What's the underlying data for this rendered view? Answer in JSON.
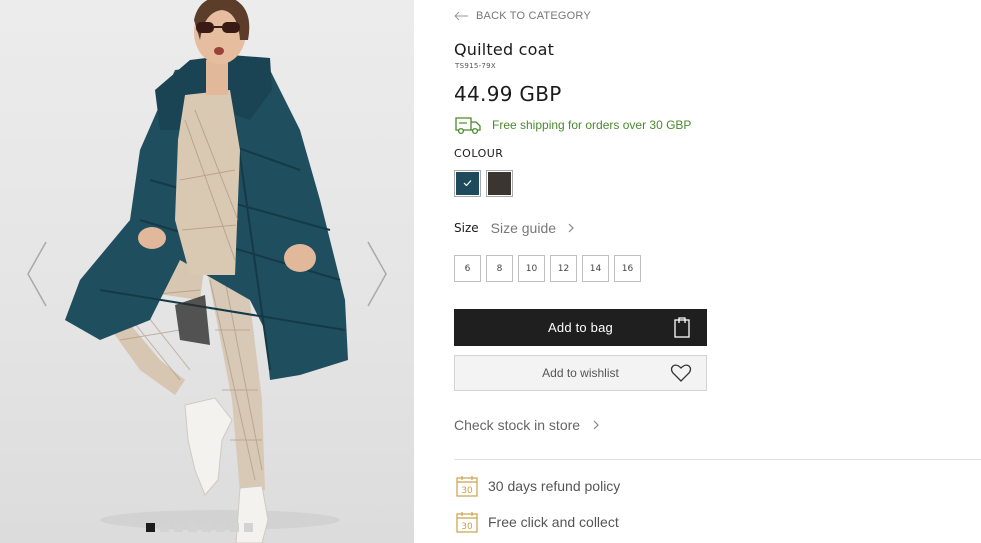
{
  "gallery": {
    "image_alt": "Model wearing teal quilted coat",
    "dots_count": 8,
    "active_dot": 0
  },
  "nav": {
    "back_label": "BACK TO CATEGORY"
  },
  "product": {
    "title": "Quilted coat",
    "sku": "TS915-79X",
    "price": "44.99 GBP",
    "shipping_text": "Free shipping for orders over 30 GBP",
    "shipping_color": "#4a8a2c"
  },
  "colour": {
    "label": "COLOUR",
    "swatches": [
      {
        "name": "teal",
        "color": "#1e4a5c",
        "selected": true
      },
      {
        "name": "dark-brown",
        "color": "#3a3530",
        "selected": false
      }
    ]
  },
  "size": {
    "label": "Size",
    "guide_label": "Size guide",
    "options": [
      "6",
      "8",
      "10",
      "12",
      "14",
      "16"
    ]
  },
  "actions": {
    "add_to_bag": "Add to bag",
    "add_to_wishlist": "Add to wishlist",
    "check_stock": "Check stock in store"
  },
  "perks": [
    {
      "icon": "calendar-icon",
      "icon_text": "30",
      "label": "30 days refund policy"
    },
    {
      "icon": "calendar-icon",
      "icon_text": "30",
      "label": "Free click and collect"
    }
  ],
  "colors": {
    "accent_gold": "#c9a24a",
    "button_dark": "#1f1f1f"
  }
}
